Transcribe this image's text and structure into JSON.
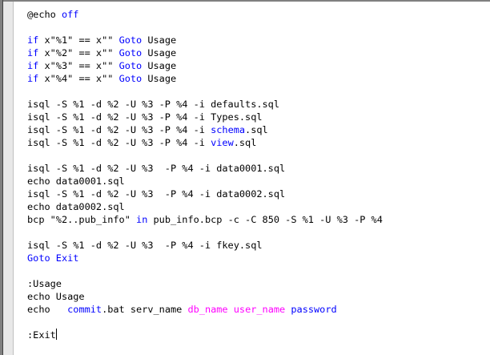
{
  "editor": {
    "colors": {
      "text": "#000000",
      "keyword": "#0000ff",
      "variable": "#ff00ff",
      "background": "#ffffff"
    },
    "lines": [
      [
        {
          "t": "@echo ",
          "c": "plain"
        },
        {
          "t": "off",
          "c": "kw"
        }
      ],
      [],
      [
        {
          "t": "if",
          "c": "kw"
        },
        {
          "t": " x\"%1\" == x\"\" ",
          "c": "plain"
        },
        {
          "t": "Goto",
          "c": "kw"
        },
        {
          "t": " Usage",
          "c": "plain"
        }
      ],
      [
        {
          "t": "if",
          "c": "kw"
        },
        {
          "t": " x\"%2\" == x\"\" ",
          "c": "plain"
        },
        {
          "t": "Goto",
          "c": "kw"
        },
        {
          "t": " Usage",
          "c": "plain"
        }
      ],
      [
        {
          "t": "if",
          "c": "kw"
        },
        {
          "t": " x\"%3\" == x\"\" ",
          "c": "plain"
        },
        {
          "t": "Goto",
          "c": "kw"
        },
        {
          "t": " Usage",
          "c": "plain"
        }
      ],
      [
        {
          "t": "if",
          "c": "kw"
        },
        {
          "t": " x\"%4\" == x\"\" ",
          "c": "plain"
        },
        {
          "t": "Goto",
          "c": "kw"
        },
        {
          "t": " Usage",
          "c": "plain"
        }
      ],
      [],
      [
        {
          "t": "isql -S %1 -d %2 -U %3 -P %4 -i defaults.sql",
          "c": "plain"
        }
      ],
      [
        {
          "t": "isql -S %1 -d %2 -U %3 -P %4 -i Types.sql",
          "c": "plain"
        }
      ],
      [
        {
          "t": "isql -S %1 -d %2 -U %3 -P %4 -i ",
          "c": "plain"
        },
        {
          "t": "schema",
          "c": "kw"
        },
        {
          "t": ".sql",
          "c": "plain"
        }
      ],
      [
        {
          "t": "isql -S %1 -d %2 -U %3 -P %4 -i ",
          "c": "plain"
        },
        {
          "t": "view",
          "c": "kw"
        },
        {
          "t": ".sql",
          "c": "plain"
        }
      ],
      [],
      [
        {
          "t": "isql -S %1 -d %2 -U %3  -P %4 -i data0001.sql",
          "c": "plain"
        }
      ],
      [
        {
          "t": "echo data0001.sql",
          "c": "plain"
        }
      ],
      [
        {
          "t": "isql -S %1 -d %2 -U %3  -P %4 -i data0002.sql",
          "c": "plain"
        }
      ],
      [
        {
          "t": "echo data0002.sql",
          "c": "plain"
        }
      ],
      [
        {
          "t": "bcp \"%2..pub_info\" ",
          "c": "plain"
        },
        {
          "t": "in",
          "c": "kw"
        },
        {
          "t": " pub_info.bcp -c -C 850 -S %1 -U %3 -P %4",
          "c": "plain"
        }
      ],
      [],
      [
        {
          "t": "isql -S %1 -d %2 -U %3  -P %4 -i fkey.sql",
          "c": "plain"
        }
      ],
      [
        {
          "t": "Goto Exit",
          "c": "kw"
        }
      ],
      [],
      [
        {
          "t": ":Usage",
          "c": "plain"
        }
      ],
      [
        {
          "t": "echo Usage",
          "c": "plain"
        }
      ],
      [
        {
          "t": "echo   ",
          "c": "plain"
        },
        {
          "t": "commit",
          "c": "kw"
        },
        {
          "t": ".bat serv_name ",
          "c": "plain"
        },
        {
          "t": "db_name",
          "c": "var"
        },
        {
          "t": " ",
          "c": "plain"
        },
        {
          "t": "user_name",
          "c": "var"
        },
        {
          "t": " ",
          "c": "plain"
        },
        {
          "t": "password",
          "c": "kw"
        }
      ],
      [],
      [
        {
          "t": ":Exit",
          "c": "plain"
        },
        {
          "t": "",
          "c": "caret"
        }
      ]
    ]
  }
}
